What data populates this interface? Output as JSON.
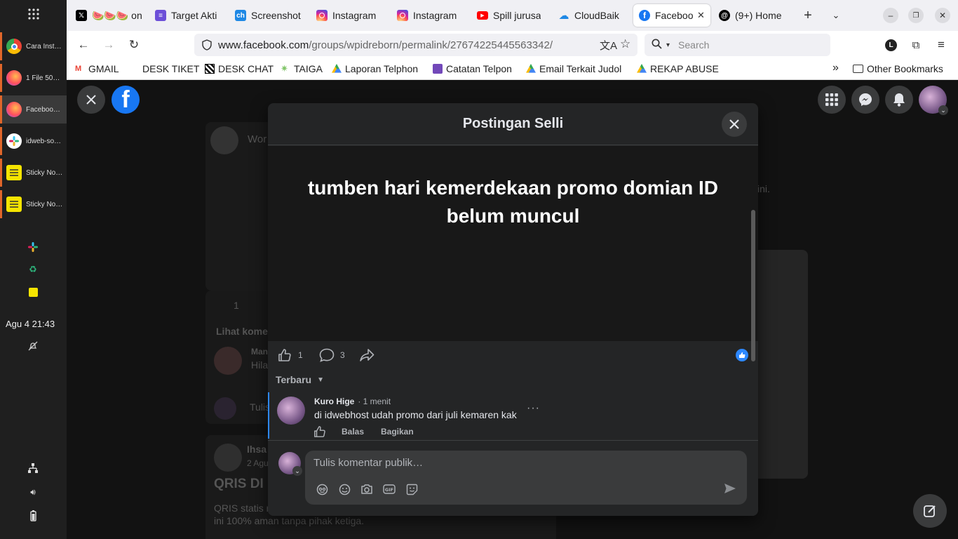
{
  "dock": {
    "items": [
      {
        "label": "Cara Inst…",
        "icon": "chrome-icon",
        "color": "#4285f4"
      },
      {
        "label": "1 File 50…",
        "icon": "firefox-icon",
        "color": "#e66000"
      },
      {
        "label": "Faceboo…",
        "icon": "firefox-icon",
        "color": "#e66000"
      },
      {
        "label": "idweb-so…",
        "icon": "slack-icon",
        "color": "#ffffff"
      },
      {
        "label": "Sticky No…",
        "icon": "sticky-notes-icon",
        "color": "#f5e400"
      },
      {
        "label": "Sticky No…",
        "icon": "sticky-notes-icon",
        "color": "#f5e400"
      }
    ],
    "clock": "Agu 4  21:43"
  },
  "tabs": [
    {
      "label": "🍉🍉🍉 on",
      "icon": "x-icon",
      "color": "#000000"
    },
    {
      "label": "Target Akti",
      "icon": "target-icon",
      "color": "#6c4fd8"
    },
    {
      "label": "Screenshot",
      "icon": "ch-icon",
      "color": "#1e88e5"
    },
    {
      "label": "Instagram",
      "icon": "instagram-icon",
      "color": "#d6249f"
    },
    {
      "label": "Instagram",
      "icon": "instagram-icon",
      "color": "#d6249f"
    },
    {
      "label": "Spill jurusa",
      "icon": "youtube-icon",
      "color": "#ff0000"
    },
    {
      "label": "CloudBaik",
      "icon": "cloud-icon",
      "color": "#1e88e5"
    },
    {
      "label": "Faceboo",
      "icon": "facebook-icon",
      "color": "#1877f2"
    },
    {
      "label": "(9+) Home",
      "icon": "threads-icon",
      "color": "#000000"
    }
  ],
  "nav": {
    "url_domain": "www.facebook.com",
    "url_path": "/groups/wpidreborn/permalink/27674225445563342/",
    "search_placeholder": "Search",
    "profile_letter": "L"
  },
  "bookmarks": [
    {
      "label": "GMAIL",
      "icon": "gmail-icon"
    },
    {
      "label": "DESK TIKET",
      "icon": "none"
    },
    {
      "label": "DESK CHAT",
      "icon": "desk-chat-icon"
    },
    {
      "label": "TAIGA",
      "icon": "taiga-icon"
    },
    {
      "label": "Laporan Telphon",
      "icon": "drive-icon"
    },
    {
      "label": "Catatan Telpon",
      "icon": "forms-icon"
    },
    {
      "label": "Email Terkait Judol",
      "icon": "drive-icon"
    },
    {
      "label": "REKAP ABUSE",
      "icon": "drive-icon"
    }
  ],
  "other_bookmarks": "Other Bookmarks",
  "background": {
    "group_name": "Wor",
    "like_count": "1",
    "see_comments": "Lihat komen",
    "comment_author": "Man",
    "comment_text": "Hila",
    "comment_placeholder": "Tulis",
    "post2_author": "Ihsa",
    "post2_date": "2 Agu",
    "post2_title": "QRIS DI",
    "post2_body1": "QRIS statis r",
    "post2_body2": "ini 100% aman tanpa pihak ketiga.",
    "right_text": "ini."
  },
  "dialog": {
    "title": "Postingan Selli",
    "post_text": "tumben hari kemerdekaan promo domian ID belum muncul",
    "like_count": "1",
    "comment_count": "3",
    "sort_label": "Terbaru",
    "comment": {
      "author": "Kuro Hige",
      "time": "· 1 menit",
      "text": "di idwebhost udah promo dari juli kemaren kak",
      "reply": "Balas",
      "share": "Bagikan"
    },
    "composer_placeholder": "Tulis komentar publik…"
  },
  "colors": {
    "facebook_blue": "#1877f2",
    "like_blue": "#2d88ff"
  }
}
